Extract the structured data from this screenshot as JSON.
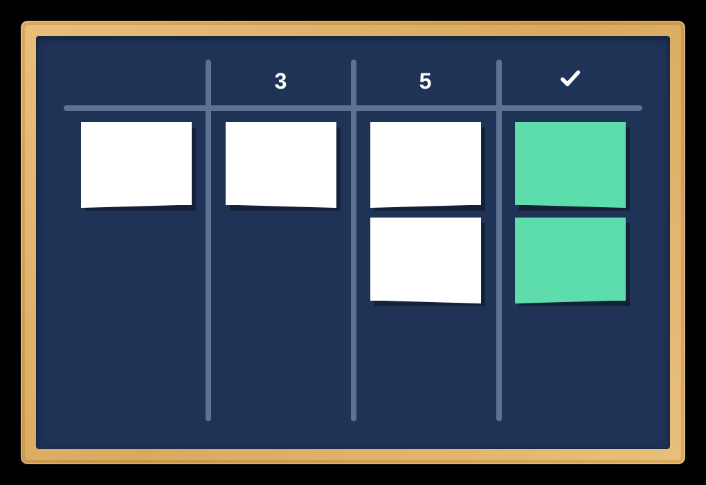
{
  "board": {
    "columns": [
      {
        "header_type": "blank",
        "header_label": "",
        "cards": [
          {
            "color": "white"
          }
        ]
      },
      {
        "header_type": "text",
        "header_label": "3",
        "cards": [
          {
            "color": "white"
          }
        ]
      },
      {
        "header_type": "text",
        "header_label": "5",
        "cards": [
          {
            "color": "white"
          },
          {
            "color": "white"
          }
        ]
      },
      {
        "header_type": "check",
        "header_label": "",
        "cards": [
          {
            "color": "green"
          },
          {
            "color": "green"
          }
        ]
      }
    ],
    "colors": {
      "board_bg": "#1f3357",
      "line": "#5f7293",
      "card_white": "#ffffff",
      "card_green": "#5ddcac",
      "frame_light": "#e8bf7a",
      "frame_dark": "#c9954a"
    }
  }
}
